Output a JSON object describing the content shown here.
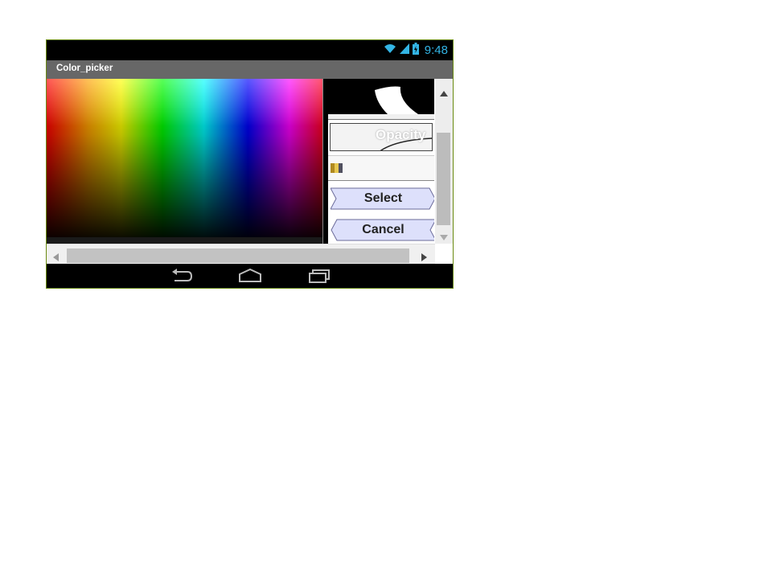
{
  "status_bar": {
    "time": "9:48",
    "icons": [
      "wifi-icon",
      "signal-icon",
      "battery-icon"
    ],
    "accent_color": "#33b5e5"
  },
  "app": {
    "title": "Color_picker"
  },
  "picker": {
    "opacity_label": "Opacity",
    "select_label": "Select",
    "cancel_label": "Cancel"
  },
  "navigation": {
    "buttons": [
      "back-icon",
      "home-icon",
      "recents-icon"
    ]
  },
  "colors": {
    "title_bar": "#676767",
    "button_fill": "#dde0fb",
    "frame": "#6a8a10"
  }
}
